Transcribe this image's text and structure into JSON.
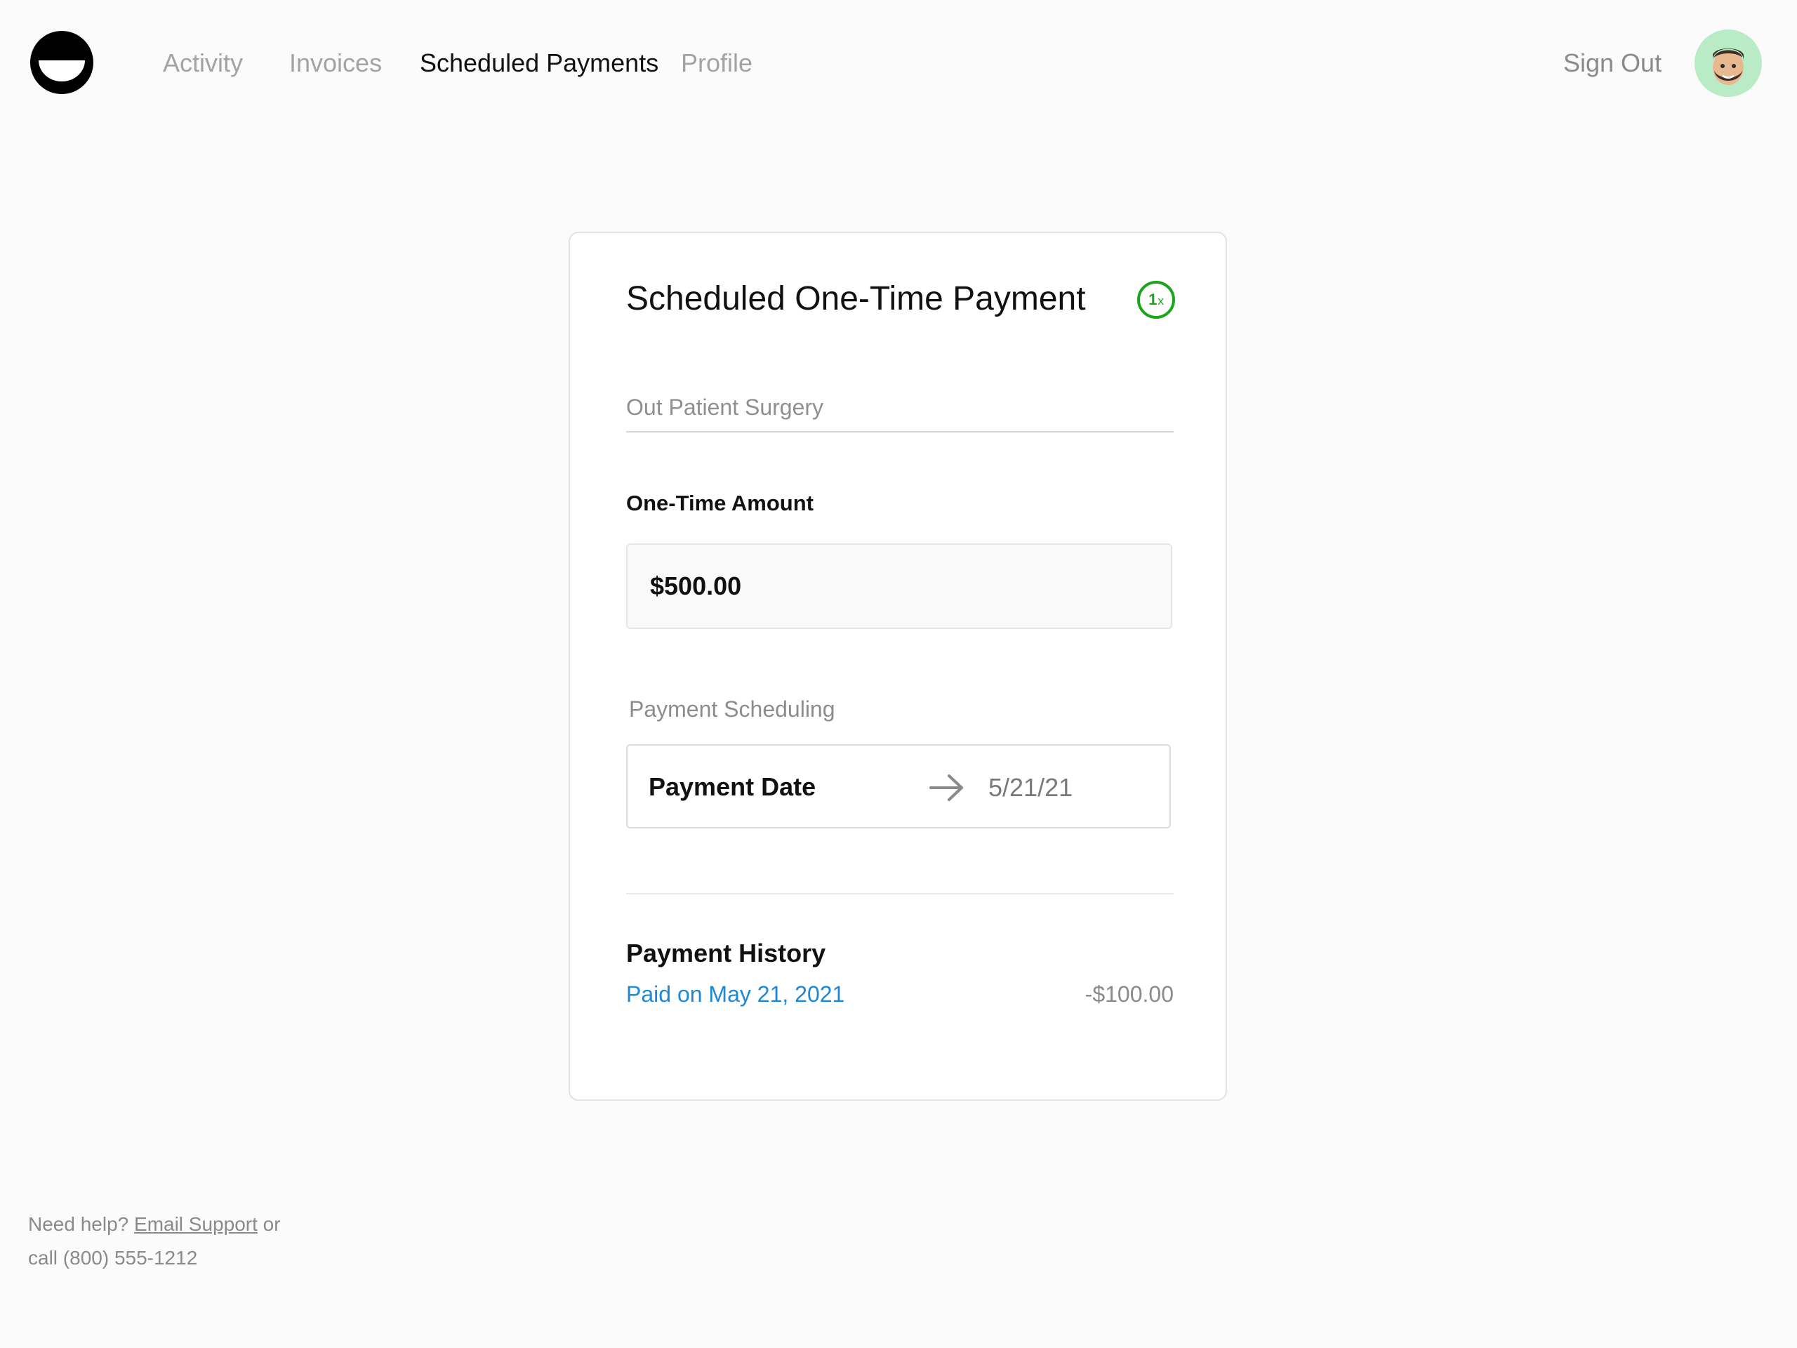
{
  "nav": {
    "items": [
      {
        "label": "Activity",
        "active": false
      },
      {
        "label": "Invoices",
        "active": false
      },
      {
        "label": "Scheduled Payments",
        "active": true
      },
      {
        "label": "Profile",
        "active": false
      }
    ],
    "sign_out": "Sign Out",
    "logo_icon": "smile-logo-icon",
    "avatar_icon": "memoji-avatar"
  },
  "card": {
    "title": "Scheduled One-Time Payment",
    "frequency_badge": {
      "number": "1",
      "suffix": "x",
      "color": "#1aa61a"
    },
    "description_value": "Out Patient Surgery",
    "amount_label": "One-Time Amount",
    "amount_value": "$500.00",
    "scheduling_label": "Payment Scheduling",
    "payment_date_label": "Payment Date",
    "arrow_icon": "arrow-right-icon",
    "payment_date_value": "5/21/21",
    "history_title": "Payment History",
    "history": [
      {
        "label": "Paid on May 21, 2021",
        "amount": "-$100.00"
      }
    ]
  },
  "footer": {
    "prefix": "Need help?",
    "link": "Email Support",
    "suffix": "or",
    "phone_line": "call (800) 555-1212"
  },
  "colors": {
    "background": "#fbfbfb",
    "accent_green": "#1aa61a",
    "link_blue": "#1e88d6",
    "avatar_bg": "#b9ecc6"
  }
}
